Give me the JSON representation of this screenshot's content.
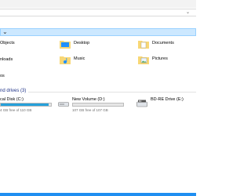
{
  "theme": {
    "accent": "#0078d7",
    "selection_bg": "#cce8ff",
    "drive_fill": "#26a0da"
  },
  "folders": [
    {
      "label": "Objects",
      "icon": "3d-objects-icon"
    },
    {
      "label": "Desktop",
      "icon": "desktop-folder-icon"
    },
    {
      "label": "Documents",
      "icon": "documents-folder-icon"
    },
    {
      "label": "nloads",
      "icon": "downloads-folder-icon"
    },
    {
      "label": "Music",
      "icon": "music-folder-icon"
    },
    {
      "label": "Pictures",
      "icon": "pictures-folder-icon"
    },
    {
      "label": "os",
      "icon": "videos-folder-icon"
    }
  ],
  "drives_section": {
    "header": "nd drives (3)"
  },
  "drives": [
    {
      "name": "cal Disk (C:)",
      "free_text": "4 GB free of 110 GB",
      "used_fraction": 0.96
    },
    {
      "name": "New Volume (D:)",
      "free_text": "107 GB free of 107 GB",
      "used_fraction": 0.0
    },
    {
      "name": "BD-RE Drive (E:)",
      "free_text": "",
      "used_fraction": null
    }
  ]
}
